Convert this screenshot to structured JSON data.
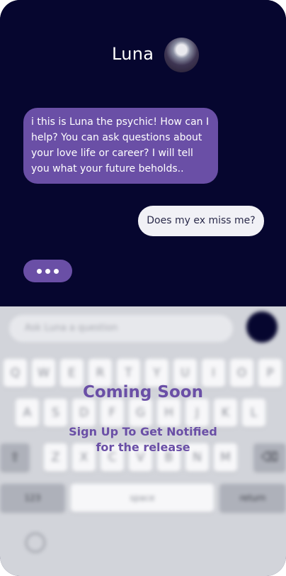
{
  "header": {
    "name": "Luna"
  },
  "messages": {
    "incoming": "i this is Luna the psychic! How can I help?  You can ask questions about your love life or career? I will tell you what your future beholds..",
    "outgoing": "Does my ex miss me?"
  },
  "composer": {
    "placeholder": "Ask Luna a question"
  },
  "keyboard": {
    "row1": [
      "Q",
      "W",
      "E",
      "R",
      "T",
      "Y",
      "U",
      "I",
      "O",
      "P"
    ],
    "row2": [
      "A",
      "S",
      "D",
      "F",
      "G",
      "H",
      "J",
      "K",
      "L"
    ],
    "row3": [
      "Z",
      "X",
      "C",
      "V",
      "B",
      "N",
      "M"
    ],
    "shift": "⇧",
    "delete": "⌫",
    "numbers": "123",
    "space": "space",
    "return": "return"
  },
  "overlay": {
    "title": "Coming Soon",
    "subtitle_line1": "Sign Up To Get Notified",
    "subtitle_line2": "for the release"
  },
  "colors": {
    "background": "#06062f",
    "accent": "#6a4fa6",
    "outgoing_bubble": "#f1f1f6"
  }
}
